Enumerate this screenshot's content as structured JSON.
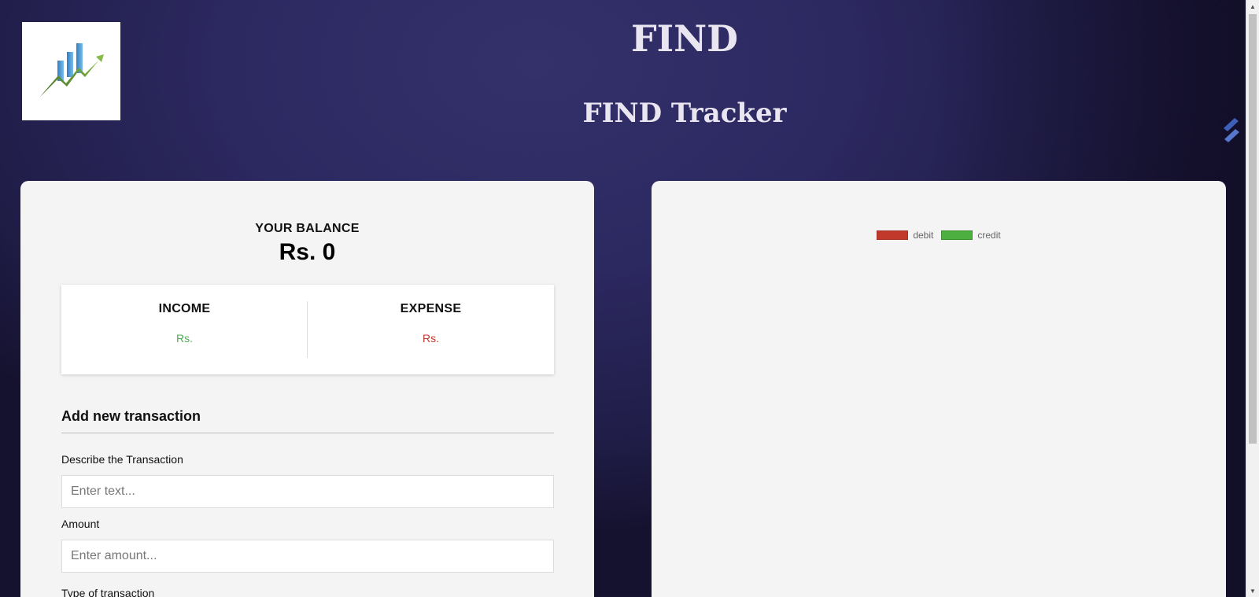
{
  "header": {
    "title": "FIND",
    "subtitle": "FIND Tracker"
  },
  "balance": {
    "label": "YOUR BALANCE",
    "value": "Rs. 0"
  },
  "summary": {
    "income_label": "INCOME",
    "income_value": "Rs.",
    "expense_label": "EXPENSE",
    "expense_value": "Rs."
  },
  "form": {
    "heading": "Add new transaction",
    "description_label": "Describe the Transaction",
    "description_placeholder": "Enter text...",
    "amount_label": "Amount",
    "amount_placeholder": "Enter amount...",
    "type_label": "Type of transaction"
  },
  "chart": {
    "legend": [
      {
        "label": "debit",
        "color": "#c0392b",
        "border": "#a93226"
      },
      {
        "label": "credit",
        "color": "#4caf3f",
        "border": "#3d8f32"
      }
    ]
  },
  "colors": {
    "income": "#4caf50",
    "expense": "#c0392b",
    "panel": "#f4f4f4",
    "title": "#e9e6f2"
  },
  "icons": {
    "logo": "growth-chart-logo",
    "side_widget": "stacked-pages-icon"
  }
}
